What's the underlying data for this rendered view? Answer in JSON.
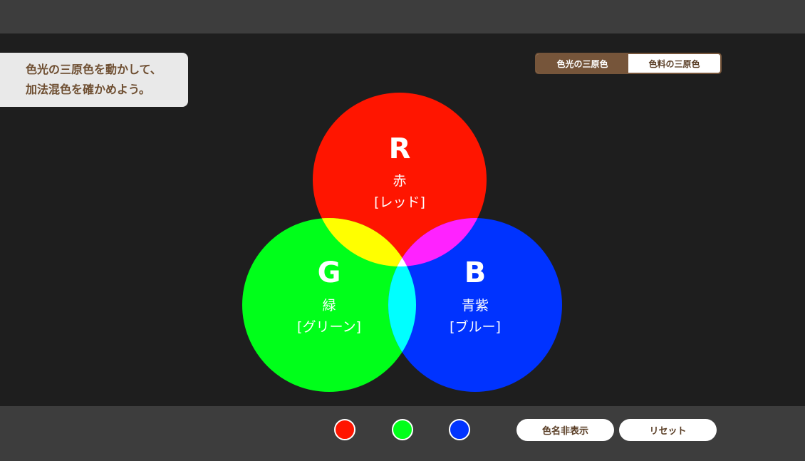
{
  "instruction": {
    "line1": "色光の三原色を動かして、",
    "line2": "加法混色を確かめよう。"
  },
  "mode_toggle": {
    "options": [
      {
        "label": "色光の三原色",
        "active": true
      },
      {
        "label": "色料の三原色",
        "active": false
      }
    ]
  },
  "circles": [
    {
      "letter": "R",
      "name": "赤",
      "reading": "[レッド]",
      "color": "#ff1500"
    },
    {
      "letter": "G",
      "name": "緑",
      "reading": "[グリーン]",
      "color": "#00ff1a"
    },
    {
      "letter": "B",
      "name": "青紫",
      "reading": "[ブルー]",
      "color": "#0033ff"
    }
  ],
  "overlaps": {
    "red_green": "#ffff00",
    "red_blue": "#ff22ff",
    "green_blue": "#00ffff",
    "center": "#ffffff"
  },
  "color_dots": [
    {
      "color": "#ff1500"
    },
    {
      "color": "#00ff1a"
    },
    {
      "color": "#0033ff"
    }
  ],
  "controls": {
    "hide_names_label": "色名非表示",
    "reset_label": "リセット"
  }
}
